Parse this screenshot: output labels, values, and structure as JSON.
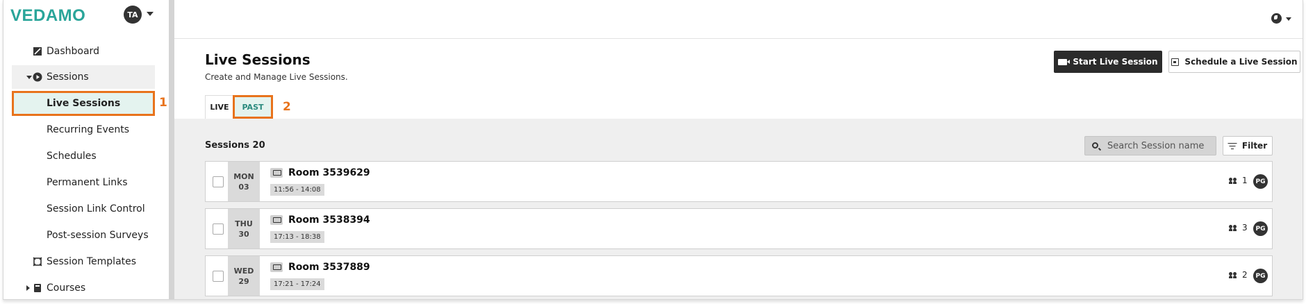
{
  "app": {
    "logo": "VEDAMO",
    "user_initials": "TA"
  },
  "sidebar": {
    "items": [
      {
        "label": "Dashboard",
        "icon": "dashboard-icon"
      },
      {
        "label": "Sessions",
        "icon": "play-circle-icon",
        "expanded": true
      },
      {
        "label": "Live Sessions",
        "active": true
      },
      {
        "label": "Recurring Events"
      },
      {
        "label": "Schedules"
      },
      {
        "label": "Permanent Links"
      },
      {
        "label": "Session Link Control"
      },
      {
        "label": "Post-session Surveys"
      },
      {
        "label": "Session Templates",
        "icon": "template-icon"
      },
      {
        "label": "Courses",
        "icon": "book-icon",
        "expanded": false
      }
    ]
  },
  "annotations": {
    "one": "1",
    "two": "2"
  },
  "header": {
    "title": "Live Sessions",
    "subtitle": "Create and Manage Live Sessions.",
    "start_button": "Start Live Session",
    "schedule_button": "Schedule a Live Session"
  },
  "tabs": [
    {
      "label": "LIVE"
    },
    {
      "label": "PAST",
      "highlighted": true
    }
  ],
  "list": {
    "count_label": "Sessions 20",
    "search_placeholder": "Search Session name",
    "filter_label": "Filter",
    "sessions": [
      {
        "day": "MON",
        "date": "03",
        "room": "Room 3539629",
        "time": "11:56 - 14:08",
        "participants": "1",
        "host": "PG"
      },
      {
        "day": "THU",
        "date": "30",
        "room": "Room 3538394",
        "time": "17:13 - 18:38",
        "participants": "3",
        "host": "PG"
      },
      {
        "day": "WED",
        "date": "29",
        "room": "Room 3537889",
        "time": "17:21 - 17:24",
        "participants": "2",
        "host": "PG"
      }
    ]
  },
  "colors": {
    "accent": "#2aa59a",
    "annotation": "#e8731c",
    "active_bg": "#e4f3ef",
    "dark_button": "#2b2b2b"
  }
}
